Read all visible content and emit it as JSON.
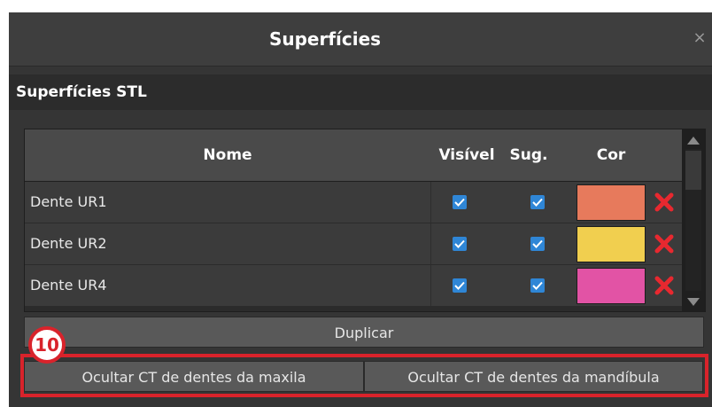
{
  "window": {
    "title": "Superfícies",
    "close_glyph": "×"
  },
  "section": {
    "title": "Superfícies STL"
  },
  "table": {
    "headers": {
      "name": "Nome",
      "visible": "Visível",
      "sug": "Sug.",
      "color": "Cor"
    },
    "rows": [
      {
        "name": "Dente UR1",
        "visible": true,
        "sug": true,
        "color": "#e77a5c"
      },
      {
        "name": "Dente UR2",
        "visible": true,
        "sug": true,
        "color": "#f1cf4f"
      },
      {
        "name": "Dente UR4",
        "visible": true,
        "sug": true,
        "color": "#e253a5"
      }
    ]
  },
  "buttons": {
    "duplicate": "Duplicar",
    "hide_maxilla": "Ocultar CT de dentes da maxila",
    "hide_mandible": "Ocultar CT de dentes da mandíbula"
  },
  "annotation": {
    "marker_number": "10",
    "color": "#d9232b"
  },
  "icons": {
    "close": "close-icon",
    "checkbox": "checkmark-icon",
    "delete": "delete-x-icon",
    "scroll_up": "scroll-up-arrow-icon",
    "scroll_down": "scroll-down-arrow-icon"
  }
}
